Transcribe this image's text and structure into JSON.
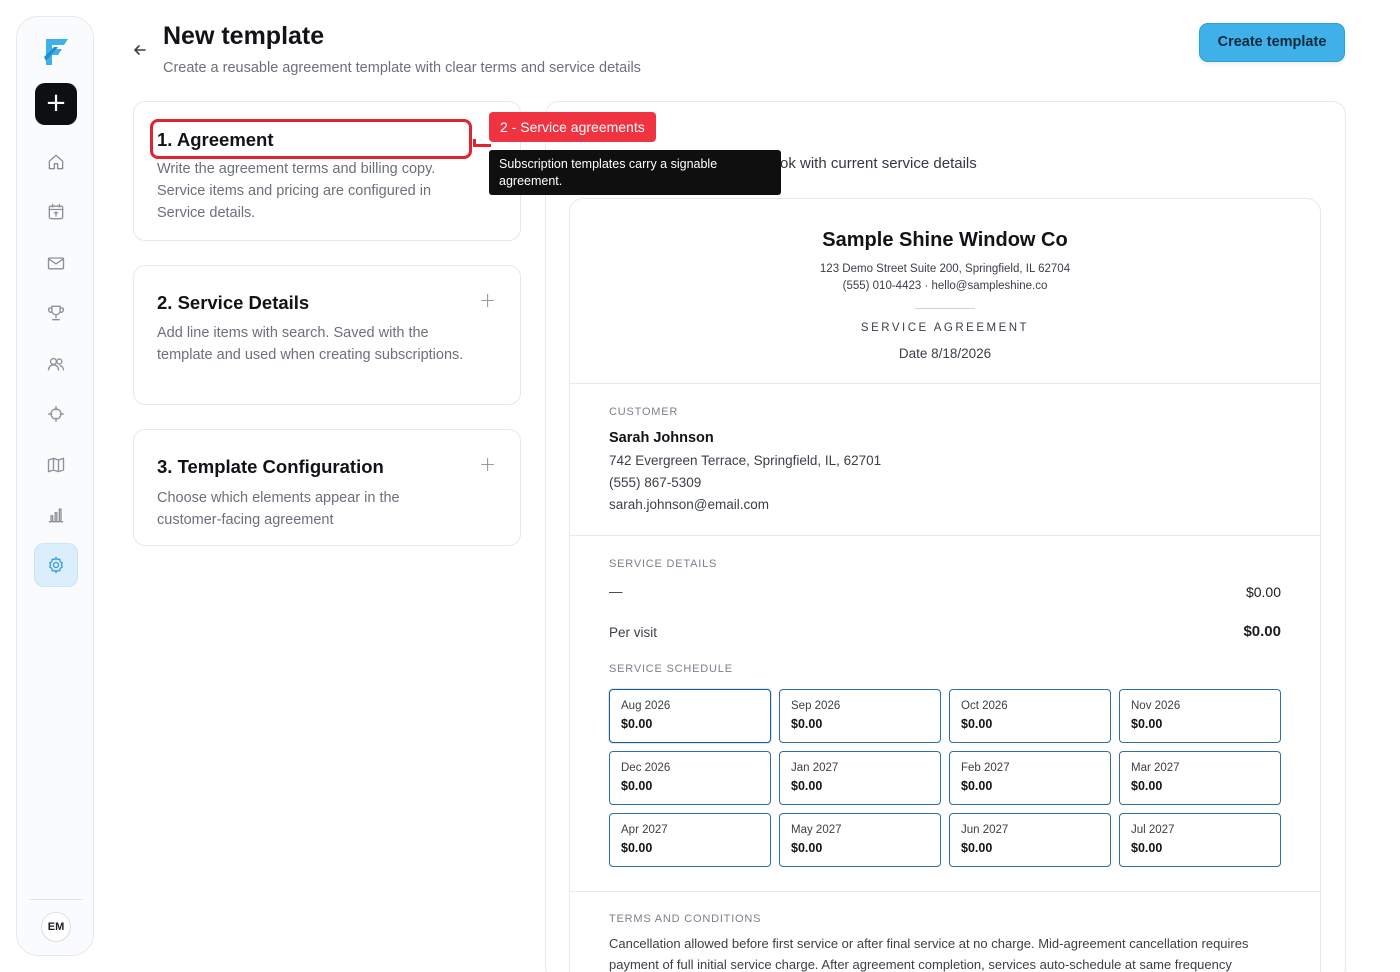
{
  "header": {
    "title": "New template",
    "subtitle": "Create a reusable agreement template with clear terms and service details",
    "create_label": "Create template"
  },
  "sidebar": {
    "items": [
      {
        "icon": "home-icon"
      },
      {
        "icon": "calendar-icon"
      },
      {
        "icon": "mail-icon"
      },
      {
        "icon": "trophy-icon"
      },
      {
        "icon": "users-icon"
      },
      {
        "icon": "crosshair-icon"
      },
      {
        "icon": "map-icon"
      },
      {
        "icon": "bar-chart-icon"
      },
      {
        "icon": "gear-icon",
        "active": true
      }
    ],
    "avatar_initials": "EM"
  },
  "sections": [
    {
      "title": "1. Agreement",
      "desc": "Write the agreement terms and billing copy. Service items and pricing are configured in Service details."
    },
    {
      "title": "2. Service Details",
      "desc": "Add line items with search. Saved with the template and used when creating subscriptions."
    },
    {
      "title": "3. Template Configuration",
      "desc": "Choose which elements appear in the customer-facing agreement"
    }
  ],
  "annotation": {
    "tag": "2 - Service agreements",
    "tooltip": "Subscription templates carry a signable agreement."
  },
  "preview": {
    "subtitle_visible": "ok with current service details",
    "company": "Sample Shine Window Co",
    "address_line1": "123 Demo Street Suite 200, Springfield, IL 62704",
    "address_line2": "(555) 010-4423 · hello@sampleshine.co",
    "doc_kind": "SERVICE AGREEMENT",
    "date": "Date 8/18/2026",
    "customer": {
      "label": "CUSTOMER",
      "name": "Sarah Johnson",
      "address": "742 Evergreen Terrace, Springfield, IL, 62701",
      "phone": "(555) 867-5309",
      "email": "sarah.johnson@email.com"
    },
    "service_details": {
      "label": "SERVICE DETAILS",
      "item_name": "—",
      "item_price": "$0.00",
      "per_visit_label": "Per visit",
      "per_visit_price": "$0.00"
    },
    "schedule": {
      "label": "SERVICE SCHEDULE",
      "months": [
        {
          "month": "Aug 2026",
          "amount": "$0.00"
        },
        {
          "month": "Sep 2026",
          "amount": "$0.00"
        },
        {
          "month": "Oct 2026",
          "amount": "$0.00"
        },
        {
          "month": "Nov 2026",
          "amount": "$0.00"
        },
        {
          "month": "Dec 2026",
          "amount": "$0.00"
        },
        {
          "month": "Jan 2027",
          "amount": "$0.00"
        },
        {
          "month": "Feb 2027",
          "amount": "$0.00"
        },
        {
          "month": "Mar 2027",
          "amount": "$0.00"
        },
        {
          "month": "Apr 2027",
          "amount": "$0.00"
        },
        {
          "month": "May 2027",
          "amount": "$0.00"
        },
        {
          "month": "Jun 2027",
          "amount": "$0.00"
        },
        {
          "month": "Jul 2027",
          "amount": "$0.00"
        }
      ]
    },
    "terms": {
      "label": "TERMS AND CONDITIONS",
      "text": "Cancellation allowed before first service or after final service at no charge. Mid-agreement cancellation requires payment of full initial service charge. After agreement completion, services auto-schedule at same frequency"
    }
  },
  "colors": {
    "accent": "#3fb1e8",
    "highlight": "#e0242f",
    "tag_bg": "#ef3340"
  }
}
